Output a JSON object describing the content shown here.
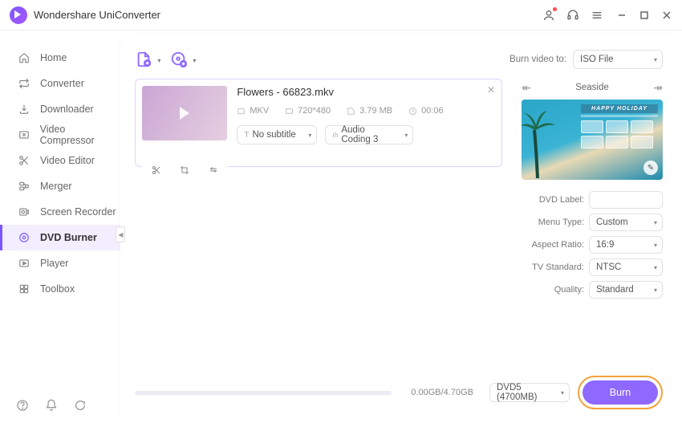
{
  "title": "Wondershare UniConverter",
  "sidebar": {
    "items": [
      {
        "label": "Home"
      },
      {
        "label": "Converter"
      },
      {
        "label": "Downloader"
      },
      {
        "label": "Video Compressor"
      },
      {
        "label": "Video Editor"
      },
      {
        "label": "Merger"
      },
      {
        "label": "Screen Recorder"
      },
      {
        "label": "DVD Burner"
      },
      {
        "label": "Player"
      },
      {
        "label": "Toolbox"
      }
    ]
  },
  "top": {
    "burn_to_label": "Burn video to:",
    "burn_to_value": "ISO File"
  },
  "video": {
    "filename": "Flowers - 66823.mkv",
    "format": "MKV",
    "resolution": "720*480",
    "size": "3.79 MB",
    "duration": "00:06",
    "subtitle_label": "No subtitle",
    "audio_label": "Audio Coding 3"
  },
  "theme": {
    "name": "Seaside",
    "banner": "HAPPY HOLIDAY"
  },
  "form": {
    "dvd_label_label": "DVD Label:",
    "dvd_label_value": "",
    "menu_type_label": "Menu Type:",
    "menu_type_value": "Custom",
    "aspect_label": "Aspect Ratio:",
    "aspect_value": "16:9",
    "tv_label": "TV Standard:",
    "tv_value": "NTSC",
    "quality_label": "Quality:",
    "quality_value": "Standard"
  },
  "bottom": {
    "size_text": "0.00GB/4.70GB",
    "disc_value": "DVD5 (4700MB)",
    "burn_label": "Burn"
  }
}
